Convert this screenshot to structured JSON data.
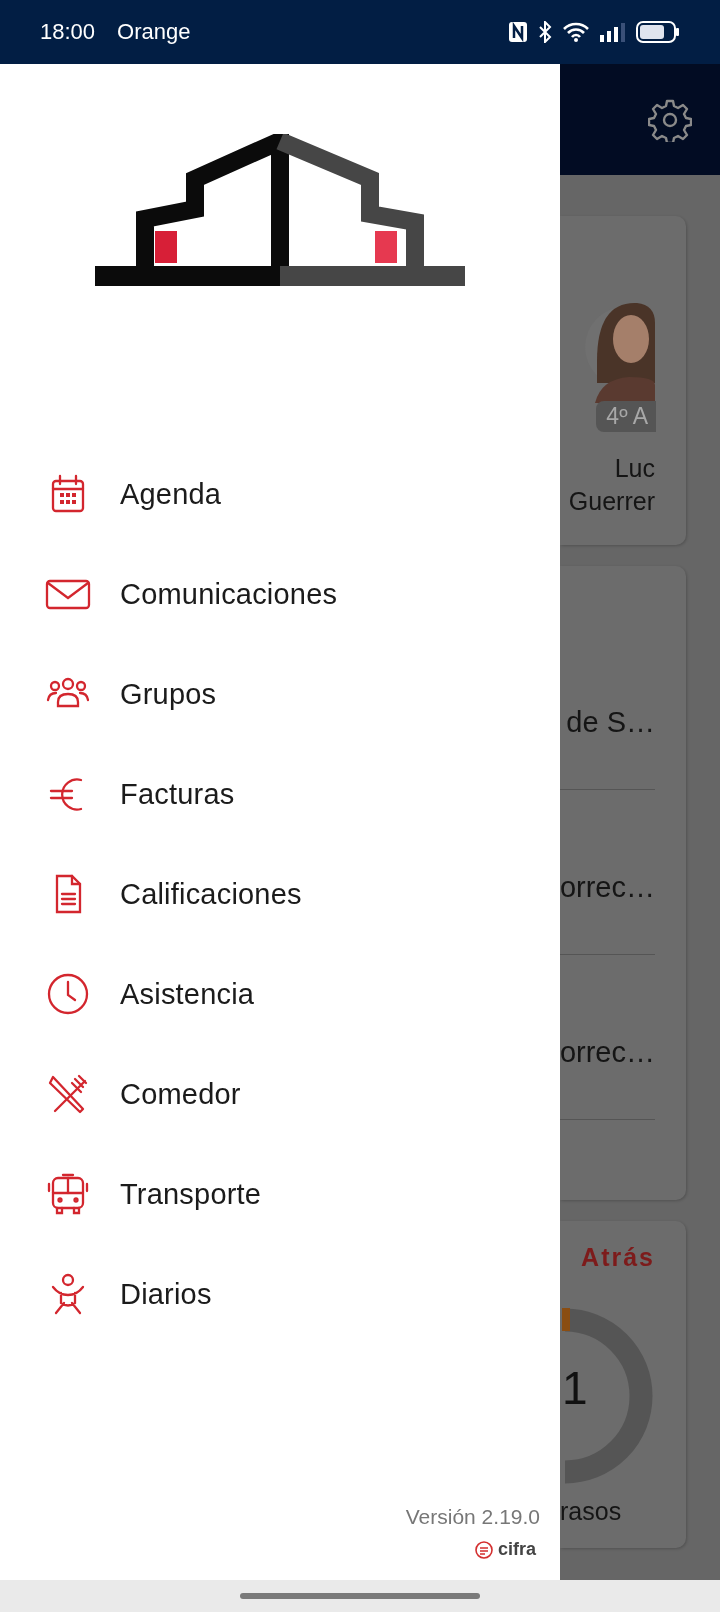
{
  "status_bar": {
    "time": "18:00",
    "carrier": "Orange"
  },
  "drawer": {
    "menu": [
      {
        "label": "Agenda",
        "kind": "calendar"
      },
      {
        "label": "Comunicaciones",
        "kind": "mail"
      },
      {
        "label": "Grupos",
        "kind": "group"
      },
      {
        "label": "Facturas",
        "kind": "euro"
      },
      {
        "label": "Calificaciones",
        "kind": "document"
      },
      {
        "label": "Asistencia",
        "kind": "clock"
      },
      {
        "label": "Comedor",
        "kind": "cutlery"
      },
      {
        "label": "Transporte",
        "kind": "bus"
      },
      {
        "label": "Diarios",
        "kind": "baby"
      }
    ],
    "version": "Versión 2.19.0",
    "brand": "cifra"
  },
  "background": {
    "student_card": {
      "badge": "4º A",
      "first_name": "Luc",
      "last_name": "Guerrer"
    },
    "list_items": [
      "de S…",
      "orrec…",
      "orrec…"
    ],
    "summary": {
      "action": "Atrás",
      "count": "1",
      "caption": "rasos"
    }
  }
}
